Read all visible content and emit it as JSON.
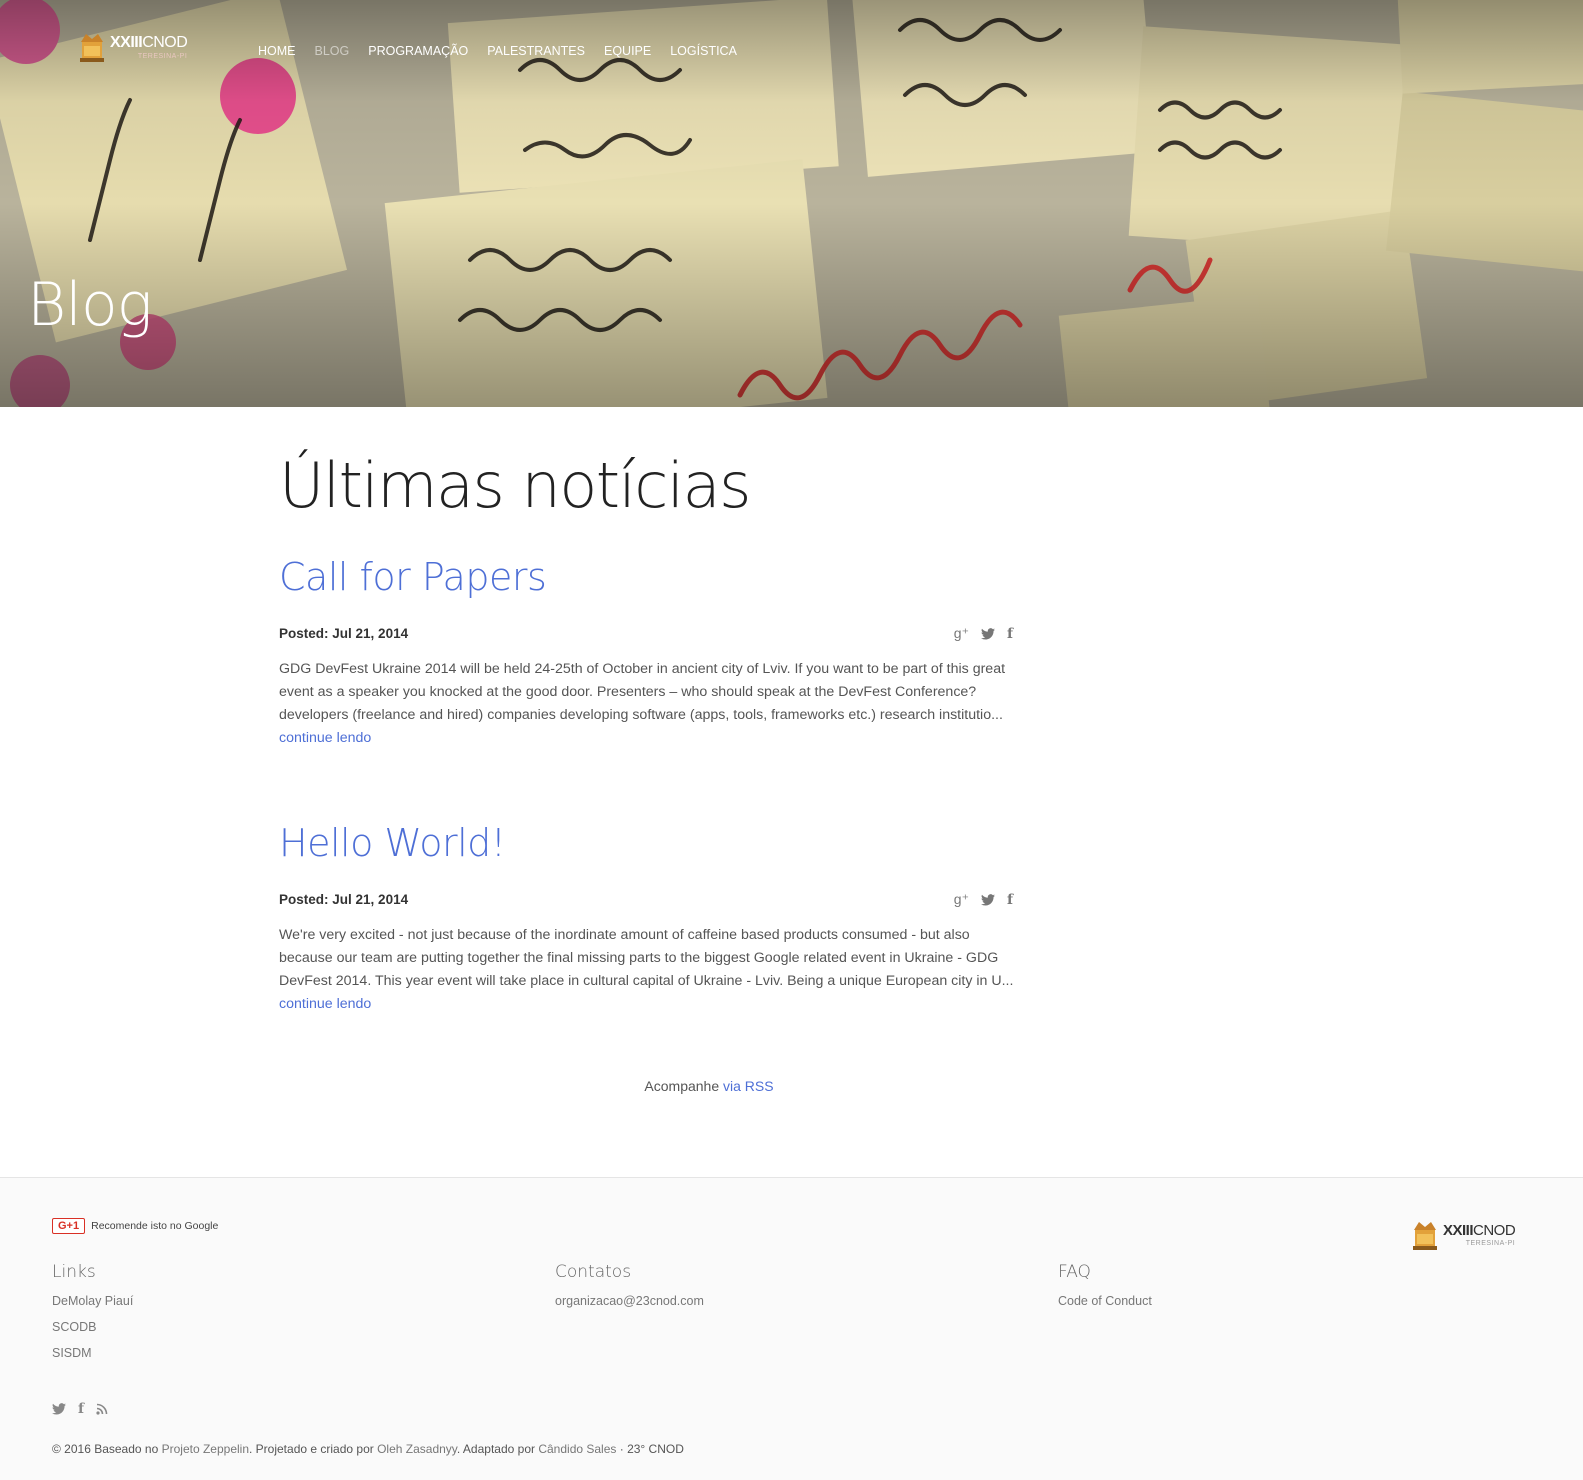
{
  "header": {
    "brand": {
      "name_bold": "XXIII",
      "name_rest": "CNOD",
      "subtitle": "TERESINA-PI"
    },
    "nav": [
      {
        "label": "HOME",
        "active": false
      },
      {
        "label": "BLOG",
        "active": true
      },
      {
        "label": "PROGRAMAÇÃO",
        "active": false
      },
      {
        "label": "PALESTRANTES",
        "active": false
      },
      {
        "label": "EQUIPE",
        "active": false
      },
      {
        "label": "LOGÍSTICA",
        "active": false
      }
    ],
    "hero_title": "Blog"
  },
  "main": {
    "title": "Últimas notícias",
    "posts": [
      {
        "title": "Call for Papers",
        "posted_label": "Posted:",
        "date": "Jul 21, 2014",
        "body": "GDG DevFest Ukraine 2014 will be held 24-25th of October in ancient city of Lviv. If you want to be part of this great event as a speaker you knocked at the good door. Presenters – who should speak at the DevFest Conference? developers (freelance and hired) companies developing software (apps, tools, frameworks etc.) research institutio...",
        "more": "continue lendo"
      },
      {
        "title": "Hello World!",
        "posted_label": "Posted:",
        "date": "Jul 21, 2014",
        "body": "We're very excited - not just because of the inordinate amount of caffeine based products consumed - but also because our team are putting together the final missing parts to the biggest Google related event in Ukraine - GDG DevFest 2014. This year event will take place in cultural capital of Ukraine - Lviv. Being a unique European city in U...",
        "more": "continue lendo"
      }
    ],
    "share_icons": [
      "google-plus-icon",
      "twitter-icon",
      "facebook-icon"
    ],
    "rss_prefix": "Acompanhe",
    "rss_link": "via RSS"
  },
  "footer": {
    "gplus_badge": "G+1",
    "gplus_text": "Recomende isto no Google",
    "brand": {
      "name_bold": "XXIII",
      "name_rest": "CNOD",
      "subtitle": "TERESINA-PI"
    },
    "columns": [
      {
        "title": "Links",
        "items": [
          "DeMolay Piauí",
          "SCODB",
          "SISDM"
        ]
      },
      {
        "title": "Contatos",
        "items": [
          "organizacao@23cnod.com"
        ]
      },
      {
        "title": "FAQ",
        "items": [
          "Code of Conduct"
        ]
      }
    ],
    "social_icons": [
      "twitter-icon",
      "facebook-icon",
      "rss-icon"
    ],
    "copyright": {
      "prefix": "© 2016 Baseado no",
      "link1": "Projeto Zeppelin",
      "mid1": ". Projetado e criado por",
      "link2": "Oleh Zasadnyy",
      "mid2": ". Adaptado por",
      "link3": "Cândido Sales",
      "suffix": "· 23° CNOD"
    }
  },
  "colors": {
    "accent": "#4e6fd6",
    "text": "#555555",
    "footer_bg": "#fafafa"
  }
}
